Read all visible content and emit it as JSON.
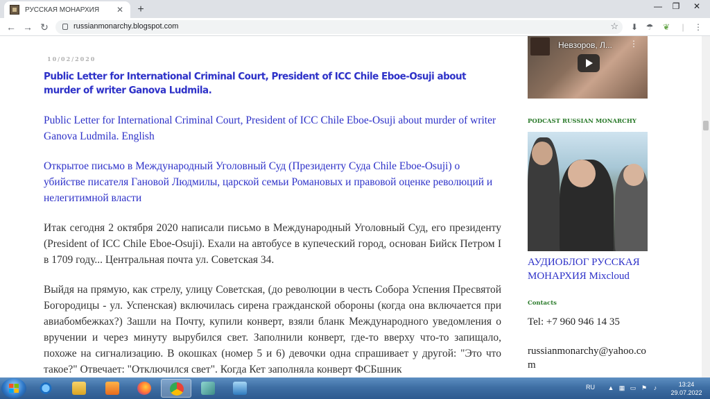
{
  "browser": {
    "tab_title": "РУССКАЯ МОНАРХИЯ",
    "url": "russianmonarchy.blogspot.com"
  },
  "post": {
    "date": "10/02/2020",
    "title": "Public Letter for International Criminal Court, President of ICC Chile Eboe-Osuji about murder of writer Ganova Ludmila.",
    "paragraphs": [
      "Public Letter for International Criminal Court, President of ICC Chile Eboe-Osuji about murder of writer Ganova Ludmila. English",
      "Открытое письмо в Международный Уголовный Суд (Президенту Суда Chile Eboe-Osuji) о убийстве писателя Гановой Людмилы, царской семьи Романовых и правовой оценке революций и нелегитимной власти",
      "Итак сегодня 2 октября 2020 написали письмо в Международный Уголовный Суд, его президенту (President of ICC Chile Eboe-Osuji). Ехали на автобусе в купеческий город, основан Бийск Петром I в 1709 году... Центральная почта ул. Советская 34.",
      "Выйдя на прямую, как стрелу, улицу Советская, (до революции в честь Собора Успения Пресвятой Богородицы - ул. Успенская) включилась сирена гражданской обороны (когда она включается при авиабомбежках?) Зашли на Почту, купили конверт, взяли бланк Международного уведомления о вручении и через минуту вырубился свет. Заполнили конверт, где-то вверху что-то запищало, похоже на сигнализацию. В окошках (номер 5 и 6) девочки одна спрашивает у другой: \"Это что такое?\" Отвечает: \"Отключился свет\". Когда Кет заполняла конверт ФСБшник"
    ]
  },
  "sidebar": {
    "video_title": "Невзоров, Л...",
    "podcast_heading": "PODCAST RUSSIAN MONARCHY",
    "podcast_link": "АУДИОБЛОГ РУССКАЯ МОНАРХИЯ Mixcloud",
    "contacts_heading": "Contacts",
    "phone": "Tel: +7 960 946 14 35",
    "email": "russianmonarchy@yahoo.com"
  },
  "taskbar": {
    "language": "RU",
    "time": "13:24",
    "date": "29.07.2022"
  }
}
